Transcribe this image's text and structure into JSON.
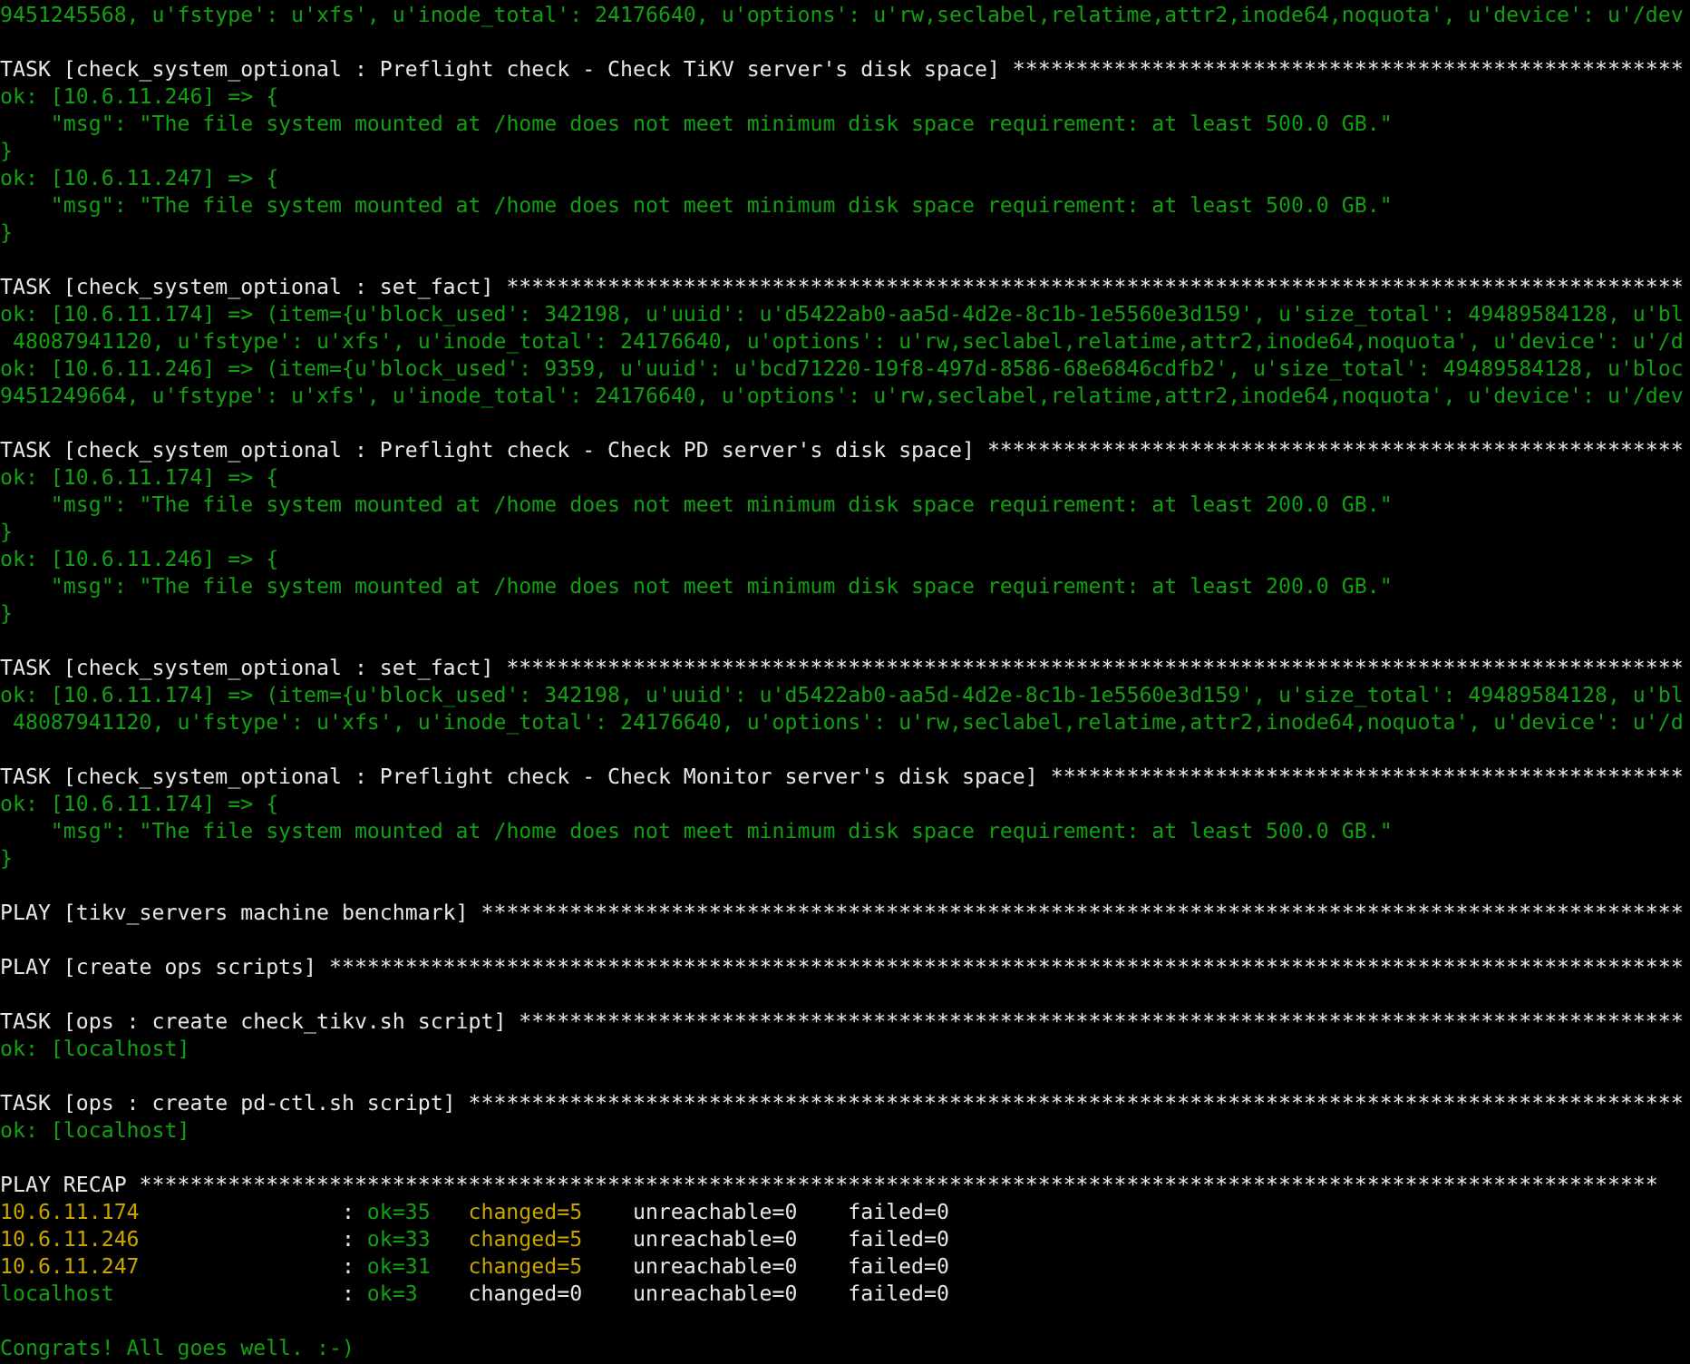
{
  "lines": [
    {
      "kind": "output",
      "text": "9451245568, u'fstype': u'xfs', u'inode_total': 24176640, u'options': u'rw,seclabel,relatime,attr2,inode64,noquota', u'device': u'/dev"
    },
    {
      "kind": "blank"
    },
    {
      "kind": "heading",
      "text": "TASK [check_system_optional : Preflight check - Check TiKV server's disk space] *****************************************************"
    },
    {
      "kind": "output",
      "text": "ok: [10.6.11.246] => {"
    },
    {
      "kind": "output",
      "text": "    \"msg\": \"The file system mounted at /home does not meet minimum disk space requirement: at least 500.0 GB.\""
    },
    {
      "kind": "output",
      "text": "}"
    },
    {
      "kind": "output",
      "text": "ok: [10.6.11.247] => {"
    },
    {
      "kind": "output",
      "text": "    \"msg\": \"The file system mounted at /home does not meet minimum disk space requirement: at least 500.0 GB.\""
    },
    {
      "kind": "output",
      "text": "}"
    },
    {
      "kind": "blank"
    },
    {
      "kind": "heading",
      "text": "TASK [check_system_optional : set_fact] *********************************************************************************************"
    },
    {
      "kind": "output",
      "text": "ok: [10.6.11.174] => (item={u'block_used': 342198, u'uuid': u'd5422ab0-aa5d-4d2e-8c1b-1e5560e3d159', u'size_total': 49489584128, u'bl"
    },
    {
      "kind": "output",
      "text": " 48087941120, u'fstype': u'xfs', u'inode_total': 24176640, u'options': u'rw,seclabel,relatime,attr2,inode64,noquota', u'device': u'/d"
    },
    {
      "kind": "output",
      "text": "ok: [10.6.11.246] => (item={u'block_used': 9359, u'uuid': u'bcd71220-19f8-497d-8586-68e6846cdfb2', u'size_total': 49489584128, u'bloc"
    },
    {
      "kind": "output",
      "text": "9451249664, u'fstype': u'xfs', u'inode_total': 24176640, u'options': u'rw,seclabel,relatime,attr2,inode64,noquota', u'device': u'/dev"
    },
    {
      "kind": "blank"
    },
    {
      "kind": "heading",
      "text": "TASK [check_system_optional : Preflight check - Check PD server's disk space] *******************************************************"
    },
    {
      "kind": "output",
      "text": "ok: [10.6.11.174] => {"
    },
    {
      "kind": "output",
      "text": "    \"msg\": \"The file system mounted at /home does not meet minimum disk space requirement: at least 200.0 GB.\""
    },
    {
      "kind": "output",
      "text": "}"
    },
    {
      "kind": "output",
      "text": "ok: [10.6.11.246] => {"
    },
    {
      "kind": "output",
      "text": "    \"msg\": \"The file system mounted at /home does not meet minimum disk space requirement: at least 200.0 GB.\""
    },
    {
      "kind": "output",
      "text": "}"
    },
    {
      "kind": "blank"
    },
    {
      "kind": "heading",
      "text": "TASK [check_system_optional : set_fact] *********************************************************************************************"
    },
    {
      "kind": "output",
      "text": "ok: [10.6.11.174] => (item={u'block_used': 342198, u'uuid': u'd5422ab0-aa5d-4d2e-8c1b-1e5560e3d159', u'size_total': 49489584128, u'bl"
    },
    {
      "kind": "output",
      "text": " 48087941120, u'fstype': u'xfs', u'inode_total': 24176640, u'options': u'rw,seclabel,relatime,attr2,inode64,noquota', u'device': u'/d"
    },
    {
      "kind": "blank"
    },
    {
      "kind": "heading",
      "text": "TASK [check_system_optional : Preflight check - Check Monitor server's disk space] **************************************************"
    },
    {
      "kind": "output",
      "text": "ok: [10.6.11.174] => {"
    },
    {
      "kind": "output",
      "text": "    \"msg\": \"The file system mounted at /home does not meet minimum disk space requirement: at least 500.0 GB.\""
    },
    {
      "kind": "output",
      "text": "}"
    },
    {
      "kind": "blank"
    },
    {
      "kind": "heading",
      "text": "PLAY [tikv_servers machine benchmark] ***********************************************************************************************"
    },
    {
      "kind": "blank"
    },
    {
      "kind": "heading",
      "text": "PLAY [create ops scripts] ***********************************************************************************************************"
    },
    {
      "kind": "blank"
    },
    {
      "kind": "heading",
      "text": "TASK [ops : create check_tikv.sh script] ********************************************************************************************"
    },
    {
      "kind": "output",
      "text": "ok: [localhost]"
    },
    {
      "kind": "blank"
    },
    {
      "kind": "heading",
      "text": "TASK [ops : create pd-ctl.sh script] ************************************************************************************************"
    },
    {
      "kind": "output",
      "text": "ok: [localhost]"
    },
    {
      "kind": "blank"
    },
    {
      "kind": "heading",
      "text": "PLAY RECAP ************************************************************************************************************************"
    },
    {
      "kind": "recap",
      "has_changes": true,
      "host": "10.6.11.174",
      "sep": ":",
      "ok": "ok=35",
      "changed": "changed=5",
      "unreachable": "unreachable=0",
      "failed": "failed=0"
    },
    {
      "kind": "recap",
      "has_changes": true,
      "host": "10.6.11.246",
      "sep": ":",
      "ok": "ok=33",
      "changed": "changed=5",
      "unreachable": "unreachable=0",
      "failed": "failed=0"
    },
    {
      "kind": "recap",
      "has_changes": true,
      "host": "10.6.11.247",
      "sep": ":",
      "ok": "ok=31",
      "changed": "changed=5",
      "unreachable": "unreachable=0",
      "failed": "failed=0"
    },
    {
      "kind": "recap",
      "has_changes": false,
      "host": "localhost",
      "sep": ":",
      "ok": "ok=3",
      "changed": "changed=0",
      "unreachable": "unreachable=0",
      "failed": "failed=0"
    },
    {
      "kind": "blank"
    },
    {
      "kind": "output",
      "text": "Congrats! All goes well. :-)"
    }
  ]
}
